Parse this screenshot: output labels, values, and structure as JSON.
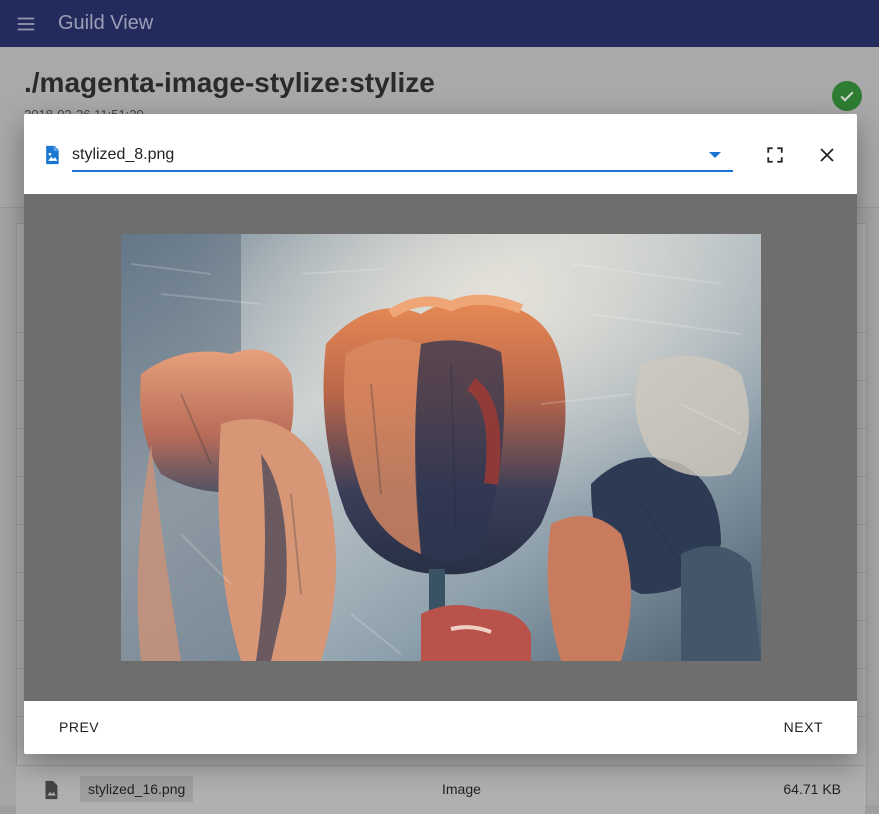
{
  "app": {
    "title": "Guild View"
  },
  "run": {
    "title": "./magenta-image-stylize:stylize",
    "timestamp": "2018-02-26 11:51:20",
    "status": "completed"
  },
  "file_row": {
    "name": "stylized_16.png",
    "type": "Image",
    "size": "64.71 KB",
    "icon": "image-file-icon"
  },
  "dialog": {
    "selected_file": "stylized_8.png",
    "file_icon": "image-file-icon",
    "fullscreen_icon": "fullscreen-icon",
    "close_icon": "close-icon",
    "prev_label": "PREV",
    "next_label": "NEXT",
    "image_subject": "stylized tulips"
  },
  "colors": {
    "appbar": "#222b5c",
    "accent": "#1976d2",
    "success": "#2e7d32",
    "viewer_bg": "#6e6e6e"
  }
}
